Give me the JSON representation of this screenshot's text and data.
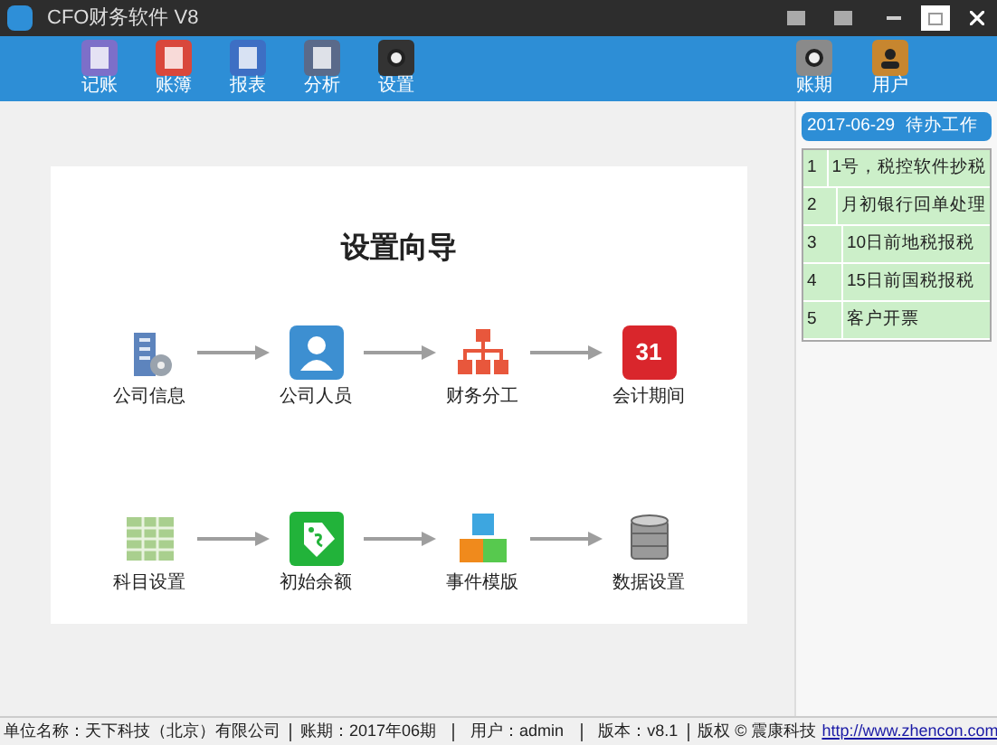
{
  "window": {
    "title": "CFO财务软件 V8"
  },
  "toolbar": [
    {
      "label": "记账",
      "kind": "ledger"
    },
    {
      "label": "账簿",
      "kind": "book"
    },
    {
      "label": "报表",
      "kind": "report"
    },
    {
      "label": "分析",
      "kind": "analysis"
    },
    {
      "label": "设置",
      "kind": "settings"
    }
  ],
  "toolbar_right": [
    {
      "label": "账期",
      "kind": "period"
    },
    {
      "label": "用户",
      "kind": "user"
    }
  ],
  "wizard": {
    "title": "设置向导",
    "rows": [
      [
        {
          "label": "公司信息",
          "kind": "building"
        },
        {
          "label": "公司人员",
          "kind": "person"
        },
        {
          "label": "财务分工",
          "kind": "org"
        },
        {
          "label": "会计期间",
          "kind": "calendar",
          "badge": "31"
        }
      ],
      [
        {
          "label": "科目设置",
          "kind": "grid"
        },
        {
          "label": "初始余额",
          "kind": "tag"
        },
        {
          "label": "事件模版",
          "kind": "blocks"
        },
        {
          "label": "数据设置",
          "kind": "database"
        }
      ]
    ]
  },
  "todo": {
    "date": "2017-06-29",
    "title": "待办工作",
    "rows": [
      {
        "index": "1",
        "task": "1号，税控软件抄税"
      },
      {
        "index": "2",
        "task": "月初银行回单处理"
      },
      {
        "index": "3",
        "task": "10日前地税报税"
      },
      {
        "index": "4",
        "task": "15日前国税报税"
      },
      {
        "index": "5",
        "task": "客户开票"
      }
    ]
  },
  "status_bar": {
    "company": "单位名称：天下科技（北京）有限公司",
    "period": "账期：2017年06期",
    "user": "用户：admin",
    "version": "版本：v8.1",
    "copyright": "版权 © 震康科技",
    "link": "http://www.zhencon.com"
  }
}
